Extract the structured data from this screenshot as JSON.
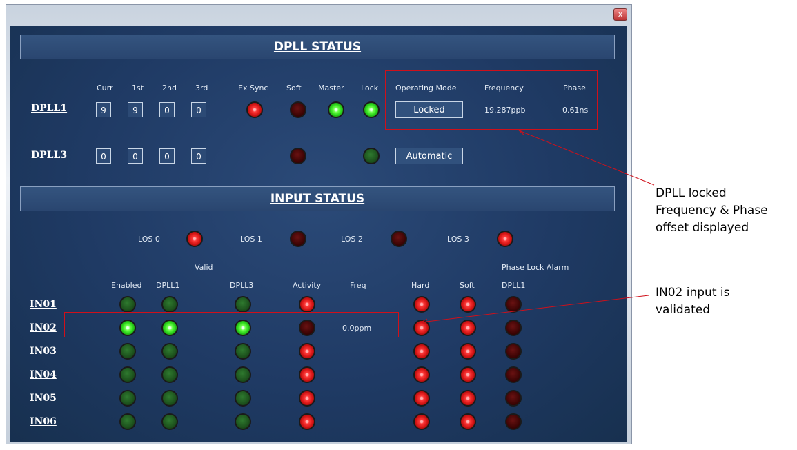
{
  "window": {
    "close_label": "x"
  },
  "dpll_status": {
    "title": "DPLL STATUS",
    "headers": {
      "curr": "Curr",
      "first": "1st",
      "second": "2nd",
      "third": "3rd",
      "ex_sync": "Ex Sync",
      "soft": "Soft",
      "master": "Master",
      "lock": "Lock",
      "operating_mode": "Operating Mode",
      "frequency": "Frequency",
      "phase": "Phase"
    },
    "dpll1": {
      "label": "DPLL1",
      "curr": "9",
      "first": "9",
      "second": "0",
      "third": "0",
      "ex_sync": "red",
      "soft": "dark",
      "master": "bright",
      "lock": "bright",
      "operating_mode": "Locked",
      "frequency": "19.287ppb",
      "phase": "0.61ns"
    },
    "dpll3": {
      "label": "DPLL3",
      "curr": "0",
      "first": "0",
      "second": "0",
      "third": "0",
      "soft": "dark",
      "lock": "green",
      "operating_mode": "Automatic"
    }
  },
  "input_status": {
    "title": "INPUT STATUS",
    "los": [
      {
        "label": "LOS 0",
        "state": "red"
      },
      {
        "label": "LOS 1",
        "state": "dark"
      },
      {
        "label": "LOS 2",
        "state": "dark"
      },
      {
        "label": "LOS 3",
        "state": "red"
      }
    ],
    "group_headers": {
      "valid": "Valid",
      "phase_lock_alarm": "Phase Lock Alarm"
    },
    "columns": {
      "enabled": "Enabled",
      "dpll1": "DPLL1",
      "dpll3": "DPLL3",
      "activity": "Activity",
      "freq": "Freq",
      "hard": "Hard",
      "soft": "Soft",
      "alarm_dpll1": "DPLL1"
    },
    "rows": [
      {
        "label": "IN01",
        "enabled": "green",
        "dpll1": "green",
        "dpll3": "green",
        "activity": "red",
        "freq": "",
        "hard": "red",
        "soft": "red",
        "alarm": "dark"
      },
      {
        "label": "IN02",
        "enabled": "bright",
        "dpll1": "bright",
        "dpll3": "bright",
        "activity": "dark",
        "freq": "0.0ppm",
        "hard": "red",
        "soft": "red",
        "alarm": "dark"
      },
      {
        "label": "IN03",
        "enabled": "green",
        "dpll1": "green",
        "dpll3": "green",
        "activity": "red",
        "freq": "",
        "hard": "red",
        "soft": "red",
        "alarm": "dark"
      },
      {
        "label": "IN04",
        "enabled": "green",
        "dpll1": "green",
        "dpll3": "green",
        "activity": "red",
        "freq": "",
        "hard": "red",
        "soft": "red",
        "alarm": "dark"
      },
      {
        "label": "IN05",
        "enabled": "green",
        "dpll1": "green",
        "dpll3": "green",
        "activity": "red",
        "freq": "",
        "hard": "red",
        "soft": "red",
        "alarm": "dark"
      },
      {
        "label": "IN06",
        "enabled": "green",
        "dpll1": "green",
        "dpll3": "green",
        "activity": "red",
        "freq": "",
        "hard": "red",
        "soft": "red",
        "alarm": "dark"
      }
    ]
  },
  "annotations": {
    "dpll_locked": [
      "DPLL locked",
      "Frequency & Phase",
      "offset displayed"
    ],
    "in02_validated": [
      "IN02 input is",
      "validated"
    ]
  },
  "colors": {
    "highlight": "#d0101a",
    "panel_bg": "#1f3a64"
  }
}
